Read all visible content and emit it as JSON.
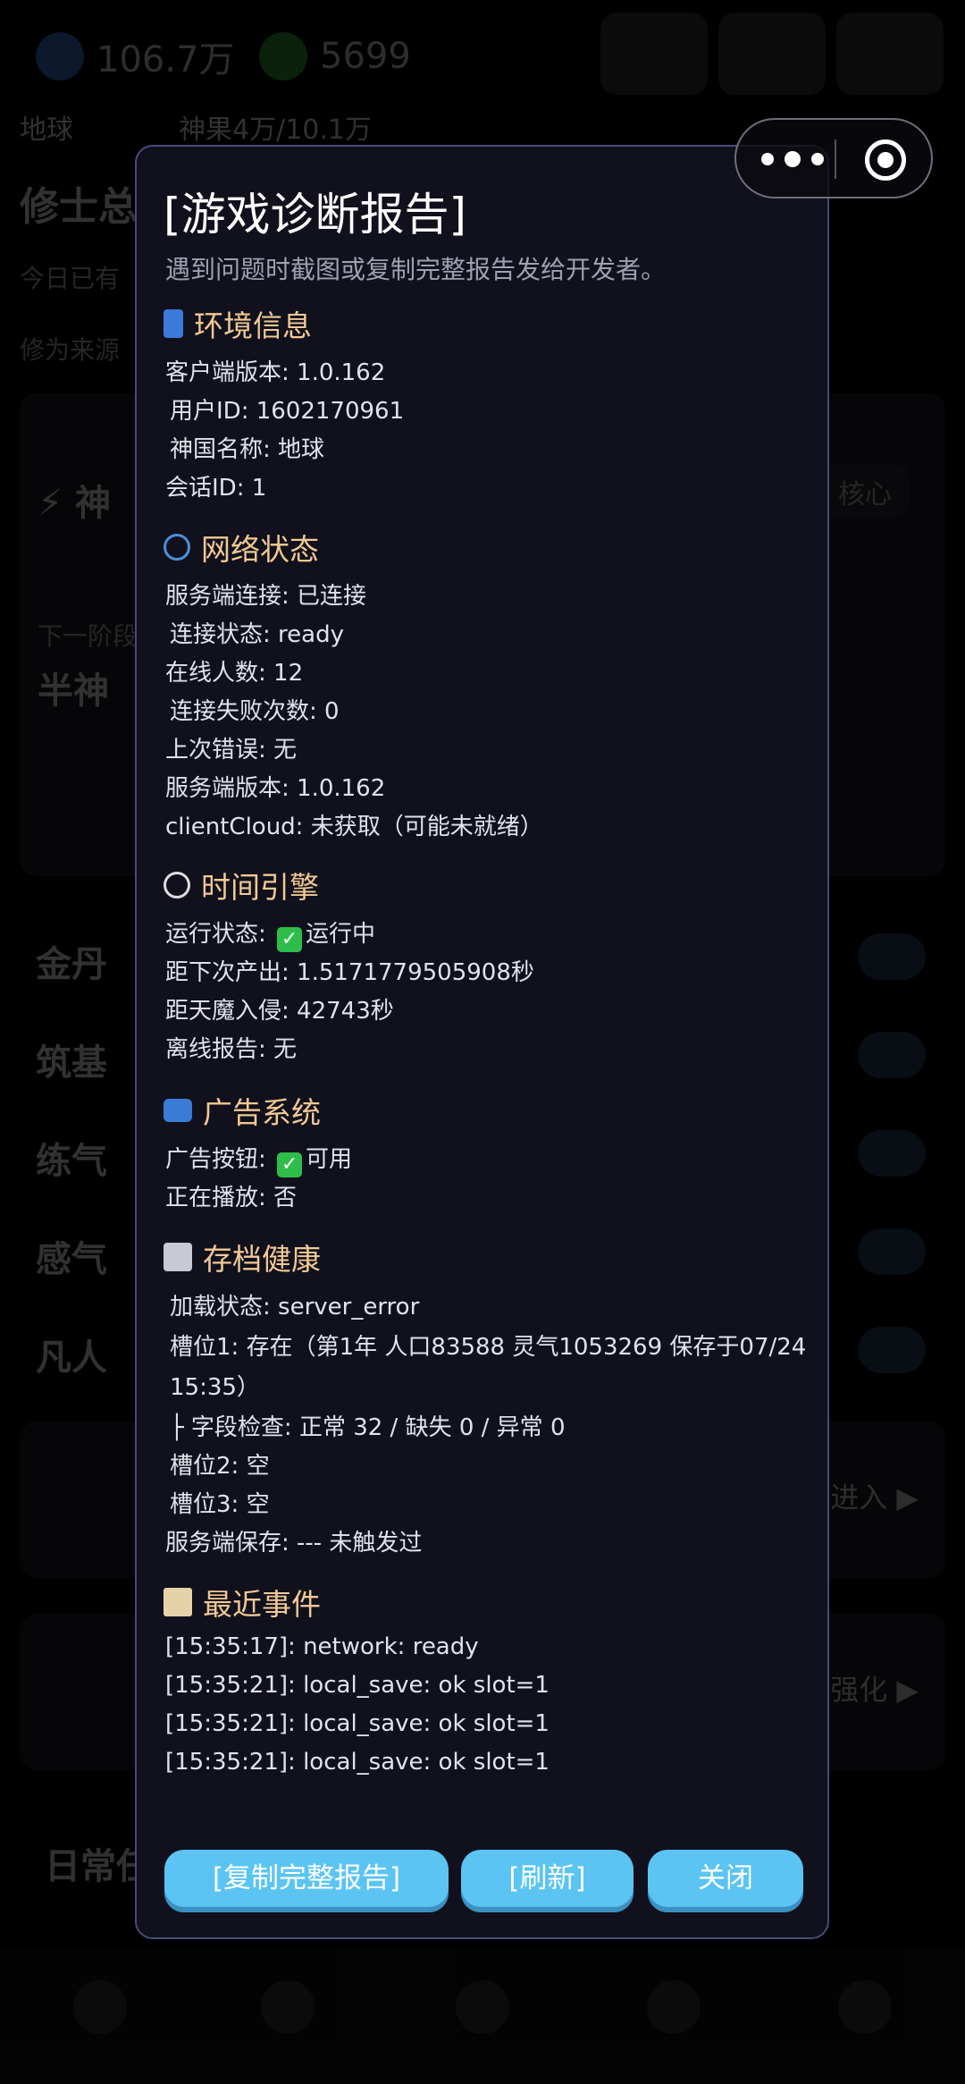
{
  "background": {
    "currency_spirit": "106.7万",
    "currency_gold": "5699",
    "nav": [
      "地球",
      "神果4万/10.1万",
      "",
      ""
    ],
    "title": "修士总",
    "line1": "今日已有",
    "line2": "修为来源",
    "card_row1": "⚡ 神",
    "card_row1_right": "核心",
    "row_label_next": "下一阶段",
    "banshen": "半神",
    "rows": [
      "金丹",
      "筑基",
      "练气",
      "感气",
      "凡人"
    ],
    "enter_label": "进入 ▶",
    "refine_label": "强化 ▶",
    "daily": "日常任"
  },
  "capsule": {
    "more_icon": "more-dots-icon",
    "close_icon": "target-close-icon"
  },
  "modal": {
    "title": "[游戏诊断报告]",
    "subtitle": "遇到问题时截图或复制完整报告发给开发者。",
    "sections": {
      "env": {
        "icon": "phone-icon",
        "title": "环境信息",
        "lines": [
          "客户端版本: 1.0.162",
          "用户ID: 1602170961",
          "神国名称: 地球",
          "会话ID: 1"
        ]
      },
      "network": {
        "icon": "globe-icon",
        "title": "网络状态",
        "lines": [
          "服务端连接: 已连接",
          "连接状态: ready",
          "在线人数: 12",
          "连接失败次数: 0",
          "上次错误: 无",
          "服务端版本: 1.0.162",
          "clientCloud: 未获取（可能未就绪）"
        ]
      },
      "engine": {
        "icon": "stopwatch-icon",
        "title": "时间引擎",
        "run_prefix": "运行状态: ",
        "run_value": "运行中",
        "lines": [
          "距下次产出: 1.5171779505908秒",
          "距天魔入侵: 42743秒",
          "离线报告: 无"
        ]
      },
      "ads": {
        "icon": "tv-icon",
        "title": "广告系统",
        "btn_prefix": "广告按钮: ",
        "btn_value": "可用",
        "playing": "正在播放: 否"
      },
      "save": {
        "icon": "floppy-disk-icon",
        "title": "存档健康",
        "lines": [
          "加载状态: server_error",
          "槽位1: 存在（第1年 人口83588 灵气1053269 保存于07/24",
          "15:35）",
          "├ 字段检查: 正常 32 / 缺失 0 / 异常 0",
          "槽位2: 空",
          "槽位3: 空",
          "服务端保存: --- 未触发过"
        ]
      },
      "events": {
        "icon": "clipboard-icon",
        "title": "最近事件",
        "lines": [
          "[15:35:17]: network: ready",
          "[15:35:21]: local_save: ok slot=1",
          "[15:35:21]: local_save: ok slot=1",
          "[15:35:21]: local_save: ok slot=1"
        ]
      }
    },
    "buttons": {
      "copy": "[复制完整报告]",
      "refresh": "[刷新]",
      "close": "关闭"
    }
  },
  "colors": {
    "accent": "#5bc4f3",
    "section_title": "#f1c994",
    "modal_bg": "#11111d",
    "modal_border": "#4a4a78",
    "check_green": "#2ebd4b"
  }
}
